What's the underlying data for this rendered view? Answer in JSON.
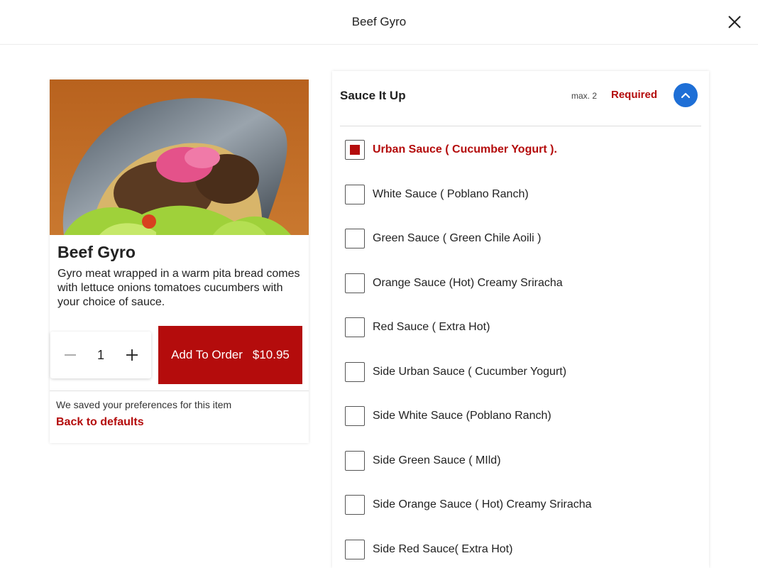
{
  "header": {
    "title": "Beef Gyro"
  },
  "item": {
    "title": "Beef Gyro",
    "description": "Gyro meat wrapped in a warm pita bread comes with lettuce onions tomatoes cucumbers with your choice of sauce.",
    "quantity": "1",
    "add_label": "Add To Order",
    "price": "$10.95",
    "saved_note": "We saved your preferences for this item",
    "defaults_link": "Back to defaults"
  },
  "options_group": {
    "title": "Sauce It Up",
    "max": "max. 2",
    "required": "Required",
    "options": [
      {
        "label": "Urban Sauce ( Cucumber Yogurt ).",
        "checked": true
      },
      {
        "label": "White Sauce ( Poblano Ranch)",
        "checked": false
      },
      {
        "label": "Green Sauce ( Green Chile Aoili )",
        "checked": false
      },
      {
        "label": "Orange Sauce (Hot) Creamy Sriracha",
        "checked": false
      },
      {
        "label": "Red Sauce ( Extra Hot)",
        "checked": false
      },
      {
        "label": "Side Urban Sauce ( Cucumber Yogurt)",
        "checked": false
      },
      {
        "label": "Side White Sauce (Poblano Ranch)",
        "checked": false
      },
      {
        "label": "Side Green Sauce ( MIld)",
        "checked": false
      },
      {
        "label": "Side Orange Sauce ( Hot) Creamy Sriracha",
        "checked": false
      },
      {
        "label": "Side Red Sauce( Extra Hot)",
        "checked": false
      }
    ]
  },
  "colors": {
    "brand_red": "#b40c0c",
    "accent_blue": "#1e6fd6"
  },
  "icons": {
    "close": "close-icon",
    "minus": "minus-icon",
    "plus": "plus-icon",
    "collapse": "chevron-up-icon"
  }
}
